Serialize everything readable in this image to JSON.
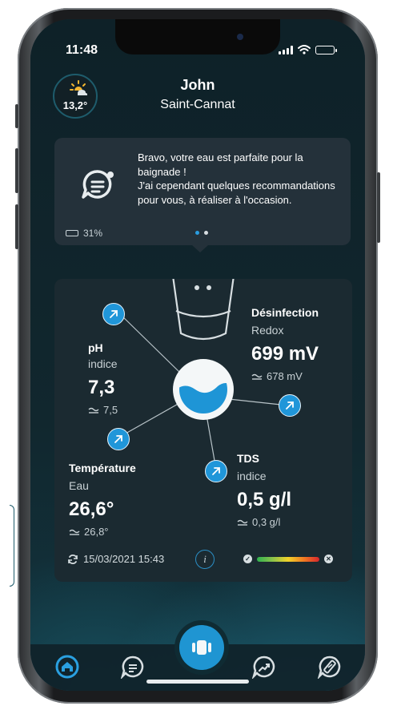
{
  "status_bar": {
    "time": "11:48"
  },
  "weather": {
    "temperature": "13,2°"
  },
  "user": {
    "name": "John",
    "city": "Saint-Cannat"
  },
  "message": {
    "text_line1": "Bravo, votre eau est parfaite pour la baignade !",
    "text_line2": "J'ai cependant quelques recommandations pour vous, à réaliser à l'occasion.",
    "battery_level": "31%",
    "page_count": 2,
    "active_page": 1
  },
  "measures": {
    "disinfection": {
      "title": "Désinfection",
      "subtitle": "Redox",
      "value": "699 mV",
      "reference": "678 mV"
    },
    "ph": {
      "title": "pH",
      "subtitle": "indice",
      "value": "7,3",
      "reference": "7,5"
    },
    "temperature": {
      "title": "Température",
      "subtitle": "Eau",
      "value": "26,6°",
      "reference": "26,8°"
    },
    "tds": {
      "title": "TDS",
      "subtitle": "indice",
      "value": "0,5 g/l",
      "reference": "0,3 g/l"
    }
  },
  "footer": {
    "last_update": "15/03/2021 15:43",
    "info_label": "i"
  },
  "colors": {
    "accent": "#2096d9",
    "card": "#1b2a31",
    "background": "#0f2b33",
    "scale_good": "#2fb24f",
    "scale_bad": "#d7262d"
  },
  "icons": {
    "nav": [
      "home-icon",
      "chat-icon",
      "device-icon",
      "trend-icon",
      "test-strip-icon"
    ],
    "status": [
      "signal-icon",
      "wifi-icon",
      "battery-icon"
    ]
  }
}
